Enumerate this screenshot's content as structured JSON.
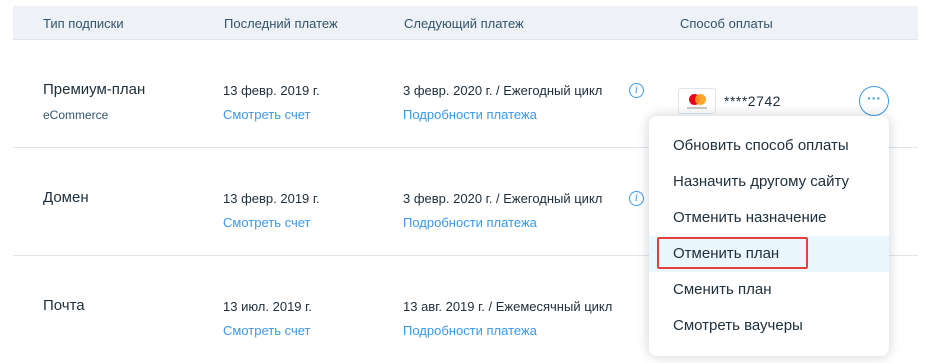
{
  "header": {
    "col_type": "Тип подписки",
    "col_last": "Последний платеж",
    "col_next": "Следующий платеж",
    "col_method": "Способ оплаты"
  },
  "rows": [
    {
      "name": "Премиум-план",
      "sub": "eCommerce",
      "last_date": "13 февр. 2019 г.",
      "view_invoice": "Смотреть счет",
      "next_payment": "3 февр. 2020 г. / Ежегодный цикл",
      "payment_details": "Подробности платежа",
      "card_number": "****2742",
      "more_label": "···"
    },
    {
      "name": "Домен",
      "last_date": "13 февр. 2019 г.",
      "view_invoice": "Смотреть счет",
      "next_payment": "3 февр. 2020 г. / Ежегодный цикл",
      "payment_details": "Подробности платежа"
    },
    {
      "name": "Почта",
      "last_date": "13 июл. 2019 г.",
      "view_invoice": "Смотреть счет",
      "next_payment": "13 авг. 2019 г. / Ежемесячный цикл",
      "payment_details": "Подробности платежа"
    }
  ],
  "info_icon": "i",
  "menu": {
    "items": [
      "Обновить способ оплаты",
      "Назначить другому сайту",
      "Отменить назначение",
      "Отменить план",
      "Сменить план",
      "Смотреть ваучеры"
    ],
    "highlighted_index": 3
  },
  "colors": {
    "accent": "#3899ec",
    "highlight": "#e5413c",
    "header_bg": "#eef1f5"
  }
}
